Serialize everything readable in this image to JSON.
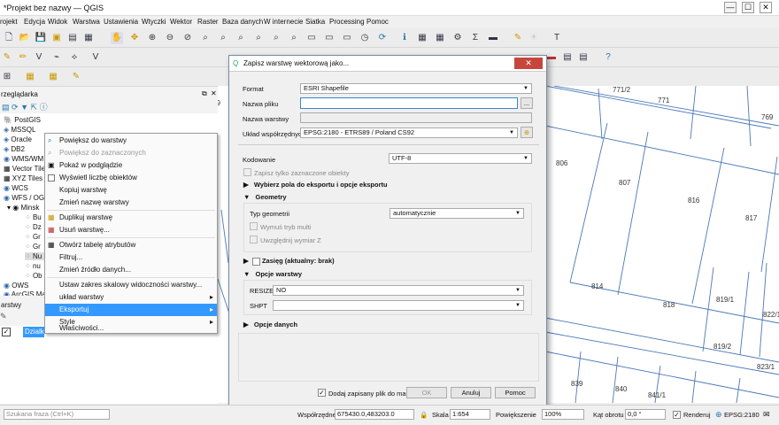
{
  "window": {
    "title": "*Projekt bez nazwy — QGIS",
    "minimize": "—",
    "maximize": "☐",
    "close": "✕"
  },
  "menu": [
    "rojekt",
    "Edycja",
    "Widok",
    "Warstwa",
    "Ustawienia",
    "Wtyczki",
    "Wektor",
    "Raster",
    "Baza danych",
    "W internecie",
    "Siatka",
    "Processing",
    "Pomoc"
  ],
  "browser": {
    "title": "rzeglądarka",
    "items": [
      "PostGIS",
      "MSSQL",
      "Oracle",
      "DB2",
      "WMS/WM",
      "Vector Tile",
      "XYZ Tiles",
      "WCS",
      "WFS / OGC",
      "Minsk",
      "Bu",
      "Dz",
      "Gr",
      "Gr",
      "Nu",
      "nu",
      "Ob",
      "OWS",
      "ArcGIS Ma"
    ]
  },
  "layers": {
    "title": "arstwy",
    "item": "Dzialk"
  },
  "context_menu": {
    "items": [
      {
        "label": "Powiększ do warstwy",
        "state": "normal"
      },
      {
        "label": "Powiększ do zaznaczonych",
        "state": "disabled"
      },
      {
        "label": "Pokaż w podglądzie",
        "state": "normal"
      },
      {
        "label": "Wyświetl liczbę obiektów",
        "state": "normal"
      },
      {
        "label": "Kopiuj warstwę",
        "state": "normal"
      },
      {
        "label": "Zmień nazwę warstwy",
        "state": "normal"
      },
      {
        "label": "Duplikuj warstwę",
        "state": "normal"
      },
      {
        "label": "Usuń warstwę...",
        "state": "normal"
      },
      {
        "label": "Otwórz tabelę atrybutów",
        "state": "normal"
      },
      {
        "label": "Filtruj...",
        "state": "normal"
      },
      {
        "label": "Zmień źródło danych...",
        "state": "normal"
      },
      {
        "label": "Ustaw zakres skalowy widoczności warstwy...",
        "state": "normal"
      },
      {
        "label": "układ warstwy",
        "state": "submenu"
      },
      {
        "label": "Eksportuj",
        "state": "selected"
      },
      {
        "label": "Style",
        "state": "submenu"
      },
      {
        "label": "Właściwości...",
        "state": "normal"
      }
    ]
  },
  "dialog": {
    "title": "Zapisz warstwę wektorową jako...",
    "format_label": "Format",
    "format_value": "ESRI Shapefile",
    "filename_label": "Nazwa pliku",
    "filename_value": "",
    "browse_label": "...",
    "layername_label": "Nazwa warstwy",
    "crs_label": "Układ współrzędnych",
    "crs_value": "EPSG:2180 - ETRS89 / Poland CS92",
    "encoding_label": "Kodowanie",
    "encoding_value": "UTF-8",
    "selected_only_label": "Zapisz tylko zaznaczone obiekty",
    "fields_section": "Wybierz pola do eksportu i opcje eksportu",
    "geometry_section": "Geometry",
    "geom_type_label": "Typ geometrii",
    "geom_type_value": "automatycznie",
    "multi_label": "Wymuś tryb multi",
    "z_label": "Uwzględnij wymiar Z",
    "extent_section": "Zasięg (aktualny: brak)",
    "layer_opts_section": "Opcje warstwy",
    "resize_label": "RESIZE",
    "resize_value": "NO",
    "shpt_label": "SHPT",
    "shpt_value": "",
    "data_opts_section": "Opcje danych",
    "add_to_map_label": "Dodaj zapisany plik do mapy",
    "ok_label": "OK",
    "cancel_label": "Anuluj",
    "help_label": "Pomoc"
  },
  "map": {
    "parcels": [
      "771/2",
      "771",
      "769",
      "806",
      "807",
      "816",
      "817",
      "814",
      "818",
      "819/1",
      "822/1",
      "819/2",
      "823/1",
      "839",
      "840",
      "841/1",
      "79"
    ]
  },
  "statusbar": {
    "search_placeholder": "Szukana fraza (Ctrl+K)",
    "coord_label": "Współrzędne",
    "coord_value": "675430.0,483203.0",
    "scale_label": "Skala",
    "scale_value": "1:654",
    "magnifier_label": "Powiększenie",
    "magnifier_value": "100%",
    "rotation_label": "Kąt obrotu",
    "rotation_value": "0,0 °",
    "render_label": "Renderuj",
    "crs_value": "EPSG:2180"
  }
}
